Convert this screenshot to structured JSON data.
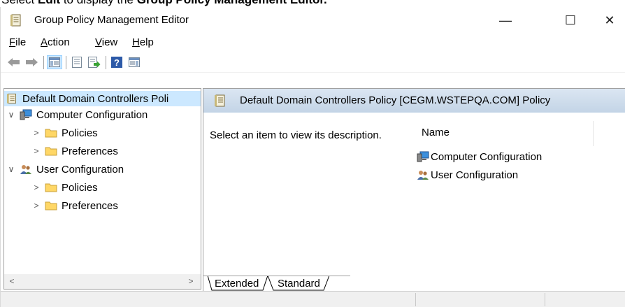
{
  "caption": {
    "prefix": "Select ",
    "bold1": "Edit",
    "middle": " to display the ",
    "bold2": "Group Policy Management Editor."
  },
  "window": {
    "title": "Group Policy Management Editor",
    "min_glyph": "—",
    "max_glyph": "☐",
    "close_glyph": "✕"
  },
  "menu": {
    "file_u": "F",
    "file_rest": "ile",
    "action_u": "A",
    "action_rest": "ction",
    "view_u": "V",
    "view_rest": "iew",
    "help_u": "H",
    "help_rest": "elp"
  },
  "toolbar": {
    "back_icon": "back-arrow-icon",
    "forward_icon": "forward-arrow-icon",
    "help_glyph": "?"
  },
  "tree": {
    "root": "Default Domain Controllers Poli",
    "computer_config": "Computer Configuration",
    "cc_policies": "Policies",
    "cc_preferences": "Preferences",
    "user_config": "User Configuration",
    "uc_policies": "Policies",
    "uc_preferences": "Preferences",
    "chev_down": "∨",
    "chev_right": ">"
  },
  "scrollbar": {
    "left": "<",
    "right": ">"
  },
  "right_pane": {
    "header": "Default Domain Controllers Policy [CEGM.WSTEPQA.COM] Policy",
    "description": "Select an item to view its description.",
    "column_name": "Name",
    "items": [
      "Computer Configuration",
      "User Configuration"
    ]
  },
  "tabs": {
    "extended": "Extended",
    "standard": "Standard"
  }
}
